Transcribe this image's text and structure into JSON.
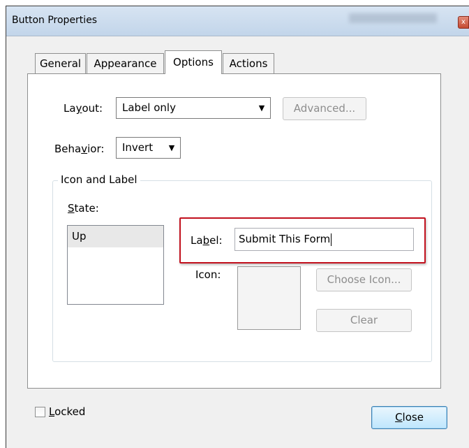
{
  "window": {
    "title": "Button Properties",
    "close_glyph": "x"
  },
  "tabs": [
    {
      "label": "General",
      "active": false
    },
    {
      "label": "Appearance",
      "active": false
    },
    {
      "label": "Options",
      "active": true
    },
    {
      "label": "Actions",
      "active": false
    }
  ],
  "options": {
    "layout": {
      "label_pre": "La",
      "label_u": "y",
      "label_post": "out:",
      "value": "Label only"
    },
    "advanced_button": "Advanced...",
    "behavior": {
      "label_pre": "Beha",
      "label_u": "v",
      "label_post": "ior:",
      "value": "Invert"
    },
    "icon_and_label": {
      "title": "Icon and Label",
      "state": {
        "label_u": "S",
        "label_post": "tate:",
        "items": [
          "Up"
        ]
      },
      "label": {
        "label_pre": "La",
        "label_u": "b",
        "label_post": "el:",
        "value": "Submit This Form"
      },
      "icon_label": "Icon:",
      "choose_icon_button": "Choose Icon...",
      "clear_button": "Clear"
    }
  },
  "footer": {
    "locked": {
      "label_u": "L",
      "label_post": "ocked",
      "checked": false
    },
    "close_button": {
      "label_u": "C",
      "label_post": "lose"
    }
  },
  "colors": {
    "highlight": "#c2111e",
    "titlebar": "#c7d8ec"
  },
  "icons": [
    "dropdown-arrow-icon",
    "close-window-icon"
  ]
}
